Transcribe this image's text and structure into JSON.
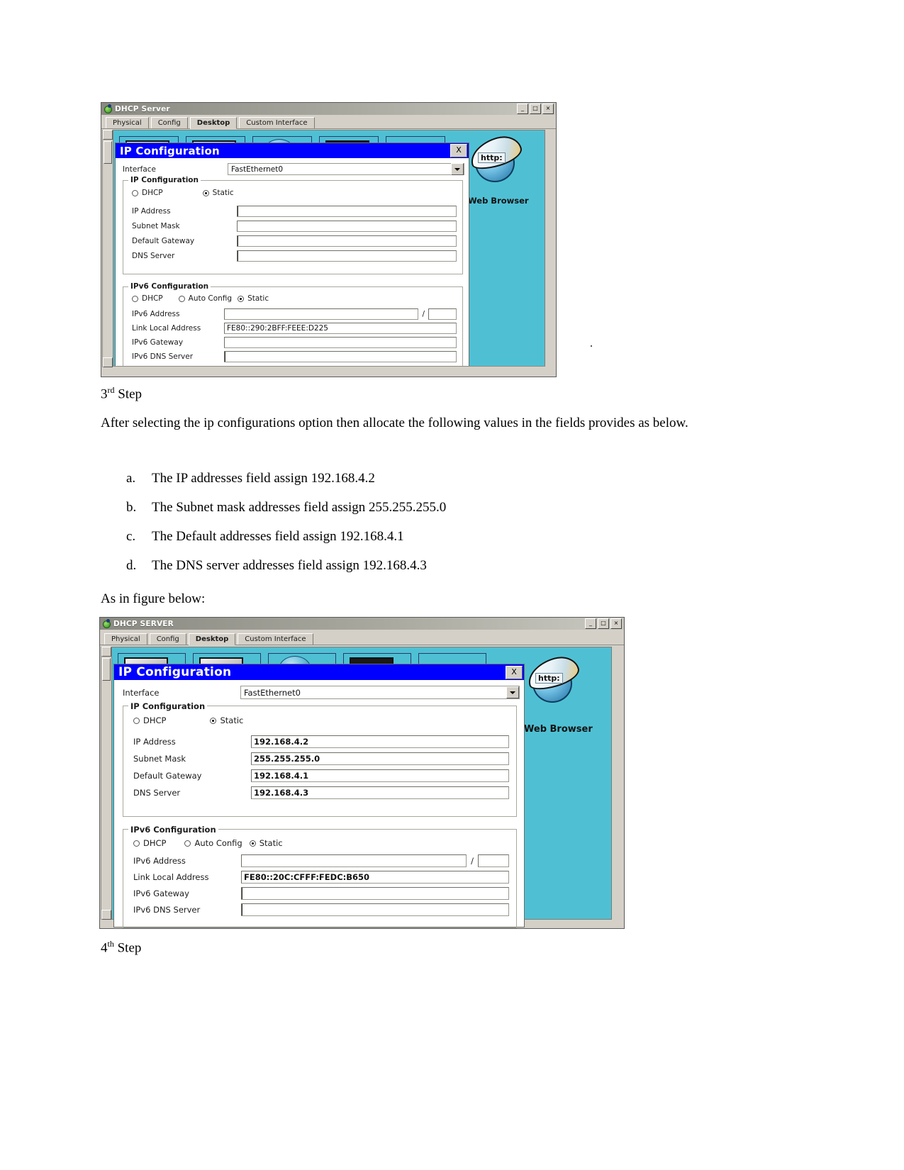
{
  "document": {
    "step3_heading": "3",
    "step3_sup": "rd",
    "step3_word": " Step",
    "paragraph": "After selecting the ip configurations option then allocate the following values in the fields provides as below.",
    "list": [
      {
        "marker": "a.",
        "text": "The IP addresses field assign 192.168.4.2"
      },
      {
        "marker": "b.",
        "text": "The Subnet mask addresses field assign 255.255.255.0"
      },
      {
        "marker": "c.",
        "text": "The Default addresses field assign 192.168.4.1"
      },
      {
        "marker": "d.",
        "text": "The DNS server addresses field assign 192.168.4.3"
      }
    ],
    "figure_caption": "As in figure below:",
    "step4_heading": "4",
    "step4_sup": "th",
    "step4_word": " Step"
  },
  "window_top": {
    "title": "DHCP Server",
    "window_buttons": [
      "_",
      "□",
      "×"
    ],
    "tabs": [
      {
        "label": "Physical",
        "active": false
      },
      {
        "label": "Config",
        "active": false
      },
      {
        "label": "Desktop",
        "active": true
      },
      {
        "label": "Custom Interface",
        "active": false
      }
    ],
    "browser_label": "Web Browser",
    "browser_http": "http:",
    "dialog": {
      "title": "IP Configuration",
      "close_label": "X",
      "interface_label": "Interface",
      "interface_value": "FastEthernet0",
      "ip_group": "IP Configuration",
      "radio_dhcp": "DHCP",
      "radio_static": "Static",
      "selected_mode": "Static",
      "fields": [
        {
          "label": "IP Address",
          "value": ""
        },
        {
          "label": "Subnet Mask",
          "value": ""
        },
        {
          "label": "Default Gateway",
          "value": ""
        },
        {
          "label": "DNS Server",
          "value": ""
        }
      ],
      "ipv6_group": "IPv6 Configuration",
      "ipv6_radio_dhcp": "DHCP",
      "ipv6_radio_auto": "Auto Config",
      "ipv6_radio_static": "Static",
      "ipv6_selected_mode": "Static",
      "ipv6_fields": [
        {
          "label": "IPv6 Address",
          "value": ""
        },
        {
          "label": "Link Local Address",
          "value": "FE80::290:2BFF:FEEE:D225"
        },
        {
          "label": "IPv6 Gateway",
          "value": ""
        },
        {
          "label": "IPv6 DNS Server",
          "value": ""
        }
      ],
      "prefix_separator": "/",
      "prefix_value": ""
    }
  },
  "window_bottom": {
    "title": "DHCP SERVER",
    "window_buttons": [
      "_",
      "□",
      "×"
    ],
    "tabs": [
      {
        "label": "Physical",
        "active": false
      },
      {
        "label": "Config",
        "active": false
      },
      {
        "label": "Desktop",
        "active": true
      },
      {
        "label": "Custom Interface",
        "active": false
      }
    ],
    "browser_label": "Web Browser",
    "browser_http": "http:",
    "dialog": {
      "title": "IP Configuration",
      "close_label": "X",
      "interface_label": "Interface",
      "interface_value": "FastEthernet0",
      "ip_group": "IP Configuration",
      "radio_dhcp": "DHCP",
      "radio_static": "Static",
      "selected_mode": "Static",
      "fields": [
        {
          "label": "IP Address",
          "value": "192.168.4.2"
        },
        {
          "label": "Subnet Mask",
          "value": "255.255.255.0"
        },
        {
          "label": "Default Gateway",
          "value": "192.168.4.1"
        },
        {
          "label": "DNS Server",
          "value": "192.168.4.3"
        }
      ],
      "ipv6_group": "IPv6 Configuration",
      "ipv6_radio_dhcp": "DHCP",
      "ipv6_radio_auto": "Auto Config",
      "ipv6_radio_static": "Static",
      "ipv6_selected_mode": "Static",
      "ipv6_fields": [
        {
          "label": "IPv6 Address",
          "value": ""
        },
        {
          "label": "Link Local Address",
          "value": "FE80::20C:CFFF:FEDC:B650"
        },
        {
          "label": "IPv6 Gateway",
          "value": ""
        },
        {
          "label": "IPv6 DNS Server",
          "value": ""
        }
      ],
      "prefix_separator": "/",
      "prefix_value": ""
    }
  }
}
